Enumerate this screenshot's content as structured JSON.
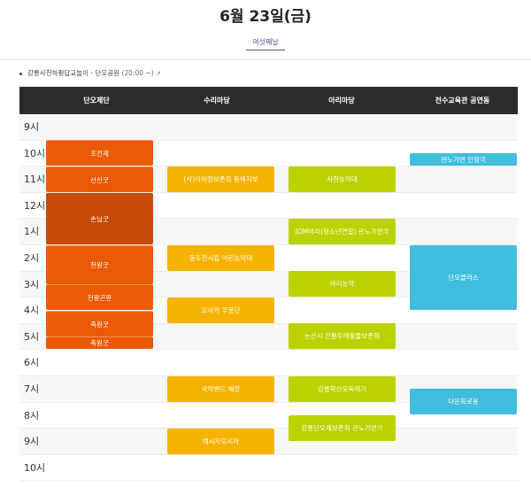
{
  "title": "6월 23일(금)",
  "subtab": "여섯째날",
  "notice": {
    "text": "강릉사천하평답교놀이 - 단오공원",
    "time": "(20:00 ~",
    "tail": ")",
    "ext_icon": "external-link-icon"
  },
  "columns": [
    "단오제단",
    "수리마당",
    "아리마당",
    "전수교육관 공연동"
  ],
  "hours": [
    "9시",
    "10시",
    "11시",
    "12시",
    "1시",
    "2시",
    "3시",
    "4시",
    "5시",
    "6시",
    "7시",
    "8시",
    "9시",
    "10시"
  ],
  "colors": {
    "orange": "#ea5904",
    "amber": "#f5b300",
    "lime": "#bcd100",
    "sky": "#41bddd",
    "header": "#2b2b2b"
  },
  "events": {
    "col1": [
      "조전제",
      "산신굿",
      "손님굿",
      "천왕굿",
      "천왕곤판",
      "축원굿",
      "축원굿"
    ],
    "col2": [
      "(사)아리랑보존회 동해지부",
      "동두천시립 어린농악대",
      "오사카 우몽단",
      "국악밴드 해랑",
      "예시자오시자"
    ],
    "col3": [
      "사천농악대",
      "JOM아리(청소년연합) 관노가면극",
      "아리농악",
      "논산시 전통두레풍물보존회",
      "강릉학산오독떼기",
      "강릉단오제보존회 관노가면극"
    ],
    "col4": [
      "관노가면 인형극",
      "단오클라스",
      "더운화로용"
    ]
  }
}
